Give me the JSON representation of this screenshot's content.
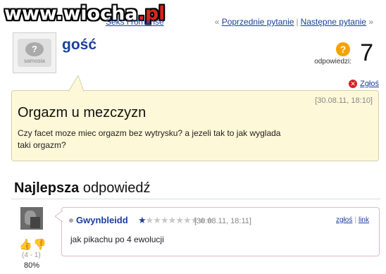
{
  "watermark": {
    "name": "www.wiocha",
    "domain": ".pl"
  },
  "breadcrumb": {
    "text": "Seks i romanse"
  },
  "question_nav": {
    "prev": "« ",
    "prev_link": "Poprzednie pytanie",
    "separator": "|",
    "next_link": "Następne pytanie",
    "next_suffix": " »"
  },
  "question": {
    "author": "gość",
    "avatar_text": "samosia",
    "answers_label": "odpowiedzi:",
    "answers_count": "7",
    "report_label": "Zgłoś",
    "date": "[30.08.11, 18:10]",
    "title": "Orgazm u mezczyzn",
    "body": "Czy facet moze miec orgazm bez wytrysku? a jezeli tak to jak wyglada taki orgazm?"
  },
  "best_answer": {
    "heading_bold": "Najlepsza",
    "heading_rest": " odpowiedź",
    "author": "Gwynbleidd",
    "rank_filled": 1,
    "rank_total": 10,
    "date": "[30.08.11, 18:11]",
    "report_link": "zgłoś",
    "link_label": "link",
    "text": "jak pikachu po 4 ewolucji",
    "votes": "(4 - 1)",
    "percent": "80%"
  },
  "colors": {
    "link": "#1a3f9c",
    "question_bg": "#fdf8d7",
    "answers_icon": "#f5a300",
    "report_icon": "#d42222"
  }
}
